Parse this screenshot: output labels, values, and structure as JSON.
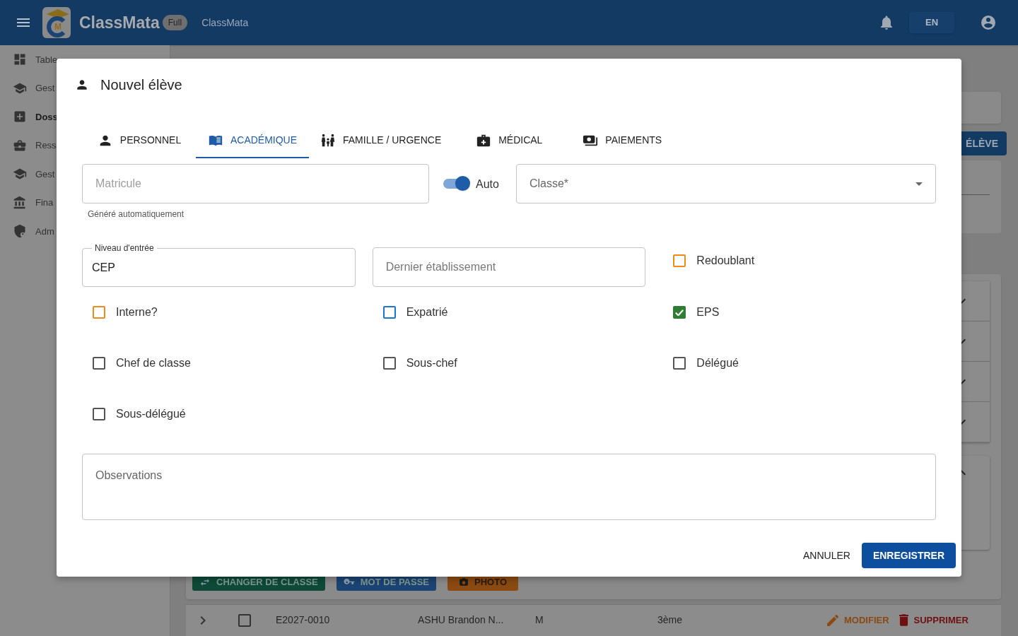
{
  "header": {
    "app_title": "ClassMata",
    "logo_letter": "M",
    "plan_badge": "Full",
    "app_name": "ClassMata",
    "language": "EN"
  },
  "sidebar": {
    "items": [
      {
        "label": "Table",
        "kind": "dashboard",
        "selected": false
      },
      {
        "label": "Gest",
        "kind": "school",
        "selected": false
      },
      {
        "label": "Doss",
        "kind": "plus",
        "selected": true
      },
      {
        "label": "Ress",
        "kind": "briefcase",
        "selected": false
      },
      {
        "label": "Gest",
        "kind": "school",
        "selected": false
      },
      {
        "label": "Fina",
        "kind": "bank",
        "selected": false
      },
      {
        "label": "Adm",
        "kind": "shield",
        "selected": false
      }
    ]
  },
  "background": {
    "add_button": "ÉLÈVE",
    "accordions": [
      {
        "expanded": false
      },
      {
        "expanded": false
      },
      {
        "expanded": false
      },
      {
        "expanded": false
      },
      {
        "expanded": true
      }
    ],
    "actions": [
      {
        "label": "CHANGER DE CLASSE",
        "kind": "swap",
        "color": "#0e4a37"
      },
      {
        "label": "MOT DE PASSE",
        "kind": "key",
        "color": "#1b4373"
      },
      {
        "label": "PHOTO",
        "kind": "camera",
        "color": "#8a4a12"
      }
    ],
    "row": {
      "checked": false,
      "cells": [
        "E2027-0010",
        "ASHU Brandon N...",
        "M",
        "3ème"
      ],
      "edit": "MODIFIER",
      "delete": "SUPPRIMER"
    }
  },
  "dialog": {
    "title": "Nouvel élève",
    "tabs": [
      {
        "label": "PERSONNEL",
        "kind": "person",
        "selected": false
      },
      {
        "label": "ACADÉMIQUE",
        "kind": "book",
        "selected": true
      },
      {
        "label": "FAMILLE / URGENCE",
        "kind": "family",
        "selected": false
      },
      {
        "label": "MÉDICAL",
        "kind": "medical",
        "selected": false
      },
      {
        "label": "PAIEMENTS",
        "kind": "payments",
        "selected": false
      }
    ],
    "matricule": {
      "placeholder": "Matricule",
      "helper": "Généré automatiquement"
    },
    "auto_switch": {
      "label": "Auto",
      "on": true
    },
    "classe": {
      "placeholder": "Classe*"
    },
    "niveau": {
      "label": "Niveau d'entrée",
      "value": "CEP"
    },
    "dernier": {
      "placeholder": "Dernier établissement"
    },
    "checkboxes": [
      {
        "label": "Redoublant",
        "checked": false,
        "color": "#ef8a1f"
      },
      {
        "label": "Interne?",
        "checked": false,
        "color": "#ef8a1f"
      },
      {
        "label": "Expatrié",
        "checked": false,
        "color": "#1976d2"
      },
      {
        "label": "EPS",
        "checked": true,
        "color": "#2e7d32"
      },
      {
        "label": "Chef de classe",
        "checked": false,
        "color": "#555555"
      },
      {
        "label": "Sous-chef",
        "checked": false,
        "color": "#555555"
      },
      {
        "label": "Délégué",
        "checked": false,
        "color": "#555555"
      },
      {
        "label": "Sous-délégué",
        "checked": false,
        "color": "#555555"
      }
    ],
    "observations": {
      "placeholder": "Observations"
    },
    "cancel": "ANNULER",
    "save": "ENREGISTRER"
  }
}
